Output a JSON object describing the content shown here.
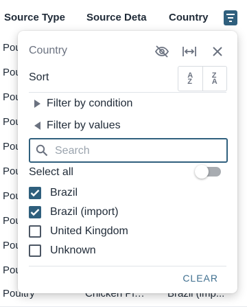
{
  "table": {
    "headers": [
      "Source Type",
      "Source Detai",
      "Country"
    ],
    "rows": [
      {
        "source_type": "Poultry",
        "source_detail": "",
        "country": ""
      },
      {
        "source_type": "Poultry",
        "source_detail": "",
        "country": ""
      },
      {
        "source_type": "Poultry",
        "source_detail": "",
        "country": ""
      },
      {
        "source_type": "Poultry",
        "source_detail": "",
        "country": ""
      },
      {
        "source_type": "Poultry",
        "source_detail": "",
        "country": ""
      },
      {
        "source_type": "Poultry",
        "source_detail": "",
        "country": ""
      },
      {
        "source_type": "Poultry",
        "source_detail": "",
        "country": ""
      },
      {
        "source_type": "Poultry",
        "source_detail": "",
        "country": ""
      },
      {
        "source_type": "Poultry",
        "source_detail": "",
        "country": ""
      },
      {
        "source_type": "Poultry",
        "source_detail": "",
        "country": ""
      },
      {
        "source_type": "Poultry",
        "source_detail": "Chicken Pie...",
        "country": "Brazil (imp..."
      }
    ]
  },
  "popup": {
    "title": "Country",
    "sort_label": "Sort",
    "sort_asc": {
      "top": "A",
      "bottom": "Z"
    },
    "sort_desc": {
      "top": "Z",
      "bottom": "A"
    },
    "filter_by_condition": "Filter by condition",
    "filter_by_values": "Filter by values",
    "search_placeholder": "Search",
    "search_value": "",
    "select_all": "Select all",
    "select_all_on": false,
    "options": [
      {
        "label": "Brazil",
        "checked": true
      },
      {
        "label": "Brazil (import)",
        "checked": true
      },
      {
        "label": "United Kingdom",
        "checked": false
      },
      {
        "label": "Unknown",
        "checked": false
      }
    ],
    "clear_label": "CLEAR"
  },
  "colors": {
    "accent": "#2f5f7d",
    "muted_icon": "#6b7280",
    "clear_text": "#3f6f8f"
  },
  "icons": {
    "header_filter": "filter-icon",
    "hide_column": "eye-off-icon",
    "resize_column": "resize-horizontal-icon",
    "close": "close-icon",
    "search": "search-icon"
  }
}
